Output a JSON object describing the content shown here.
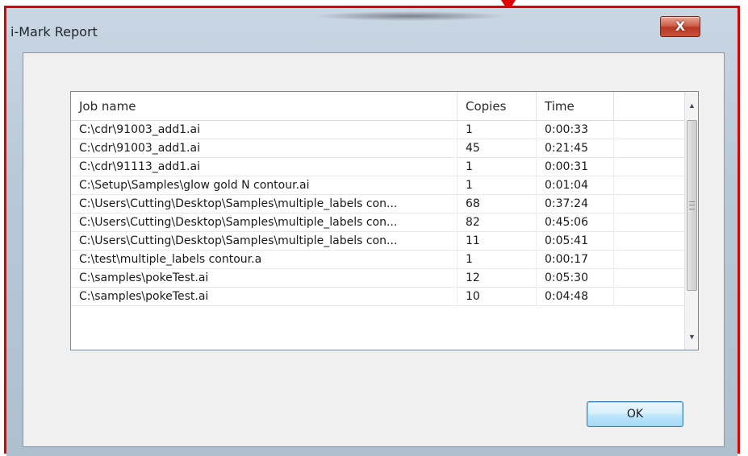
{
  "window": {
    "title": "i-Mark  Report",
    "close_icon": "close-icon",
    "close_glyph": "X"
  },
  "table": {
    "columns": [
      "Job name",
      "Copies",
      "Time",
      ""
    ],
    "rows": [
      {
        "name": "C:\\cdr\\91003_add1.ai",
        "copies": "1",
        "time": "0:00:33"
      },
      {
        "name": "C:\\cdr\\91003_add1.ai",
        "copies": "45",
        "time": "0:21:45"
      },
      {
        "name": "C:\\cdr\\91113_add1.ai",
        "copies": "1",
        "time": "0:00:31"
      },
      {
        "name": "C:\\Setup\\Samples\\glow gold N contour.ai",
        "copies": "1",
        "time": "0:01:04"
      },
      {
        "name": "C:\\Users\\Cutting\\Desktop\\Samples\\multiple_labels con...",
        "copies": "68",
        "time": "0:37:24"
      },
      {
        "name": "C:\\Users\\Cutting\\Desktop\\Samples\\multiple_labels con...",
        "copies": "82",
        "time": "0:45:06"
      },
      {
        "name": "C:\\Users\\Cutting\\Desktop\\Samples\\multiple_labels con...",
        "copies": "11",
        "time": "0:05:41"
      },
      {
        "name": "C:\\test\\multiple_labels contour.a",
        "copies": "1",
        "time": "0:00:17"
      },
      {
        "name": "C:\\samples\\pokeTest.ai",
        "copies": "12",
        "time": "0:05:30"
      },
      {
        "name": "C:\\samples\\pokeTest.ai",
        "copies": "10",
        "time": "0:04:48"
      }
    ]
  },
  "scrollbar": {
    "up_glyph": "▲",
    "down_glyph": "▼"
  },
  "buttons": {
    "ok_label": "OK"
  },
  "colors": {
    "highlight_frame": "#e00000",
    "close_button": "#c85038",
    "ok_button_border": "#3c7fb1"
  }
}
